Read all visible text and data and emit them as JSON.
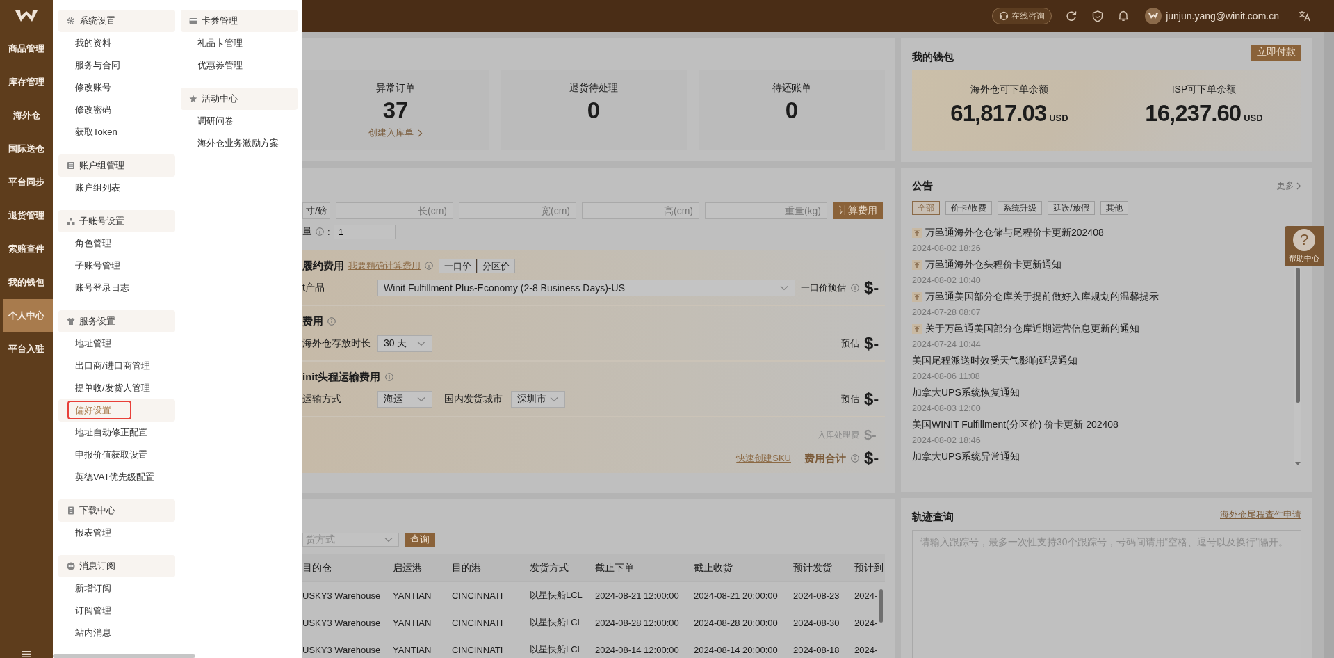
{
  "sidebar": {
    "items": [
      {
        "label": "商品管理",
        "selected": false
      },
      {
        "label": "库存管理",
        "selected": false
      },
      {
        "label": "海外仓",
        "selected": false
      },
      {
        "label": "国际送仓",
        "selected": false
      },
      {
        "label": "平台同步",
        "selected": false
      },
      {
        "label": "退货管理",
        "selected": false
      },
      {
        "label": "索赔查件",
        "selected": false
      },
      {
        "label": "我的钱包",
        "selected": false
      },
      {
        "label": "个人中心",
        "selected": true
      },
      {
        "label": "平台入驻",
        "selected": false
      }
    ]
  },
  "menu": {
    "columns": [
      {
        "groups": [
          {
            "title": "系统设置",
            "kind": "gear",
            "items": [
              {
                "label": "我的资料",
                "selected": false
              },
              {
                "label": "服务与合同",
                "selected": false
              },
              {
                "label": "修改账号",
                "selected": false
              },
              {
                "label": "修改密码",
                "selected": false
              },
              {
                "label": "获取Token",
                "selected": false
              }
            ]
          },
          {
            "title": "账户组管理",
            "kind": "table",
            "items": [
              {
                "label": "账户组列表",
                "selected": false
              }
            ]
          },
          {
            "title": "子账号设置",
            "kind": "org",
            "items": [
              {
                "label": "角色管理",
                "selected": false
              },
              {
                "label": "子账号管理",
                "selected": false
              },
              {
                "label": "账号登录日志",
                "selected": false
              }
            ]
          },
          {
            "title": "服务设置",
            "kind": "shirt",
            "items": [
              {
                "label": "地址管理",
                "selected": false
              },
              {
                "label": "出口商/进口商管理",
                "selected": false
              },
              {
                "label": "提单收/发货人管理",
                "selected": false
              },
              {
                "label": "偏好设置",
                "selected": true,
                "annotated": true
              },
              {
                "label": "地址自动修正配置",
                "selected": false
              },
              {
                "label": "申报价值获取设置",
                "selected": false
              },
              {
                "label": "英德VAT优先级配置",
                "selected": false
              }
            ]
          },
          {
            "title": "下载中心",
            "kind": "download",
            "items": [
              {
                "label": "报表管理",
                "selected": false
              }
            ]
          },
          {
            "title": "消息订阅",
            "kind": "chat",
            "items": [
              {
                "label": "新增订阅",
                "selected": false
              },
              {
                "label": "订阅管理",
                "selected": false
              },
              {
                "label": "站内消息",
                "selected": false
              }
            ]
          }
        ]
      },
      {
        "groups": [
          {
            "title": "卡券管理",
            "kind": "card",
            "items": [
              {
                "label": "礼品卡管理",
                "selected": false
              },
              {
                "label": "优惠券管理",
                "selected": false
              }
            ]
          },
          {
            "title": "活动中心",
            "kind": "star",
            "items": [
              {
                "label": "调研问卷",
                "selected": false
              },
              {
                "label": "海外仓业务激励方案",
                "selected": false
              }
            ]
          }
        ]
      }
    ]
  },
  "header": {
    "consult": "在线咨询",
    "user": "junjun.yang@winit.com.cn"
  },
  "stats": [
    {
      "label": "异常订单",
      "value": "37",
      "link": "创建入库单"
    },
    {
      "label": "退货待处理",
      "value": "0"
    },
    {
      "label": "待还账单",
      "value": "0"
    }
  ],
  "calculator": {
    "unit_button": "寸/磅",
    "inputs": [
      {
        "placeholder": "长(cm)"
      },
      {
        "placeholder": "宽(cm)"
      },
      {
        "placeholder": "高(cm)"
      },
      {
        "placeholder": "重量(kg)"
      }
    ],
    "calc_button": "计算费用",
    "quantity_label": "量",
    "quantity_suffix": ":",
    "quantity": "1",
    "fulfillment": {
      "title": "履约费用",
      "link": "我要精确计算费用",
      "modes": [
        {
          "label": "一口价",
          "selected": true
        },
        {
          "label": "分区价",
          "selected": false
        }
      ],
      "product_label": "t产品",
      "product": "Winit Fulfillment Plus-Economy (2-8 Business Days)-US",
      "estimate_label": "一口价预估",
      "amount": "$-"
    },
    "storage": {
      "title": "费用",
      "duration_label": "海外仓存放时长",
      "duration": "30 天",
      "estimate_label": "预估",
      "amount": "$-"
    },
    "first_leg": {
      "title": "init头程运输费用",
      "mode_label": "运输方式",
      "mode": "海运",
      "city_label": "国内发货城市",
      "city": "深圳市",
      "estimate_label": "预估",
      "amount": "$-"
    },
    "totals": {
      "inbound_label": "入库处理费",
      "inbound_amount": "$-",
      "sku_link": "快速创建SKU",
      "total_label": "费用合计",
      "total_amount": "$-"
    }
  },
  "routes": {
    "filter_placeholder": "货方式",
    "query_button": "查询",
    "columns": [
      "目的仓",
      "启运港",
      "目的港",
      "发货方式",
      "截止下单",
      "截止收货",
      "预计发货",
      "预计到"
    ],
    "rows": [
      [
        "USKY3 Warehouse",
        "YANTIAN",
        "CINCINNATI",
        "以星快船LCL",
        "2024-08-21 12:00:00",
        "2024-08-21 20:00:00",
        "2024-08-23",
        "2024-"
      ],
      [
        "USKY3 Warehouse",
        "YANTIAN",
        "CINCINNATI",
        "以星快船LCL",
        "2024-08-28 12:00:00",
        "2024-08-28 20:00:00",
        "2024-08-30",
        "2024-"
      ],
      [
        "USKY3 Warehouse",
        "YANTIAN",
        "CINCINNATI",
        "以星快船LCL",
        "2024-08-14 12:00:00",
        "2024-08-14 20:00:00",
        "2024-08-18",
        "2024-"
      ]
    ]
  },
  "wallet": {
    "title": "我的钱包",
    "pay_button": "立即付款",
    "balances": [
      {
        "label": "海外仓可下单余额",
        "amount": "61,817.03",
        "currency": "USD"
      },
      {
        "label": "ISP可下单余额",
        "amount": "16,237.60",
        "currency": "USD"
      }
    ]
  },
  "notices": {
    "title": "公告",
    "more": "更多",
    "tabs": [
      {
        "label": "全部",
        "selected": true
      },
      {
        "label": "价卡/收费",
        "selected": false
      },
      {
        "label": "系统升级",
        "selected": false
      },
      {
        "label": "延误/放假",
        "selected": false
      },
      {
        "label": "其他",
        "selected": false
      }
    ],
    "items": [
      {
        "title": "万邑通海外仓仓储与尾程价卡更新202408",
        "date": "2024-08-02 18:26",
        "pinned": true
      },
      {
        "title": "万邑通海外仓头程价卡更新通知",
        "date": "2024-08-02 10:40",
        "pinned": true
      },
      {
        "title": "万邑通美国部分仓库关于提前做好入库规划的温馨提示",
        "date": "2024-07-28 08:07",
        "pinned": true
      },
      {
        "title": "关于万邑通美国部分仓库近期运营信息更新的通知",
        "date": "2024-07-24 10:44",
        "pinned": true
      },
      {
        "title": "美国尾程派送时效受天气影响延误通知",
        "date": "2024-08-06 11:08",
        "pinned": false
      },
      {
        "title": "加拿大UPS系统恢复通知",
        "date": "2024-08-03 12:00",
        "pinned": false
      },
      {
        "title": "美国WINIT Fulfillment(分区价) 价卡更新 202408",
        "date": "2024-08-02 18:46",
        "pinned": false
      },
      {
        "title": "加拿大UPS系统异常通知",
        "pinned": false
      }
    ]
  },
  "help": {
    "symbol": "?",
    "label": "帮助中心"
  },
  "tracking": {
    "title": "轨迹查询",
    "link": "海外仓尾程查件申请",
    "placeholder": "请输入跟踪号，最多一次性支持30个跟踪号，号码间请用“空格、逗号以及换行”隔开。"
  }
}
